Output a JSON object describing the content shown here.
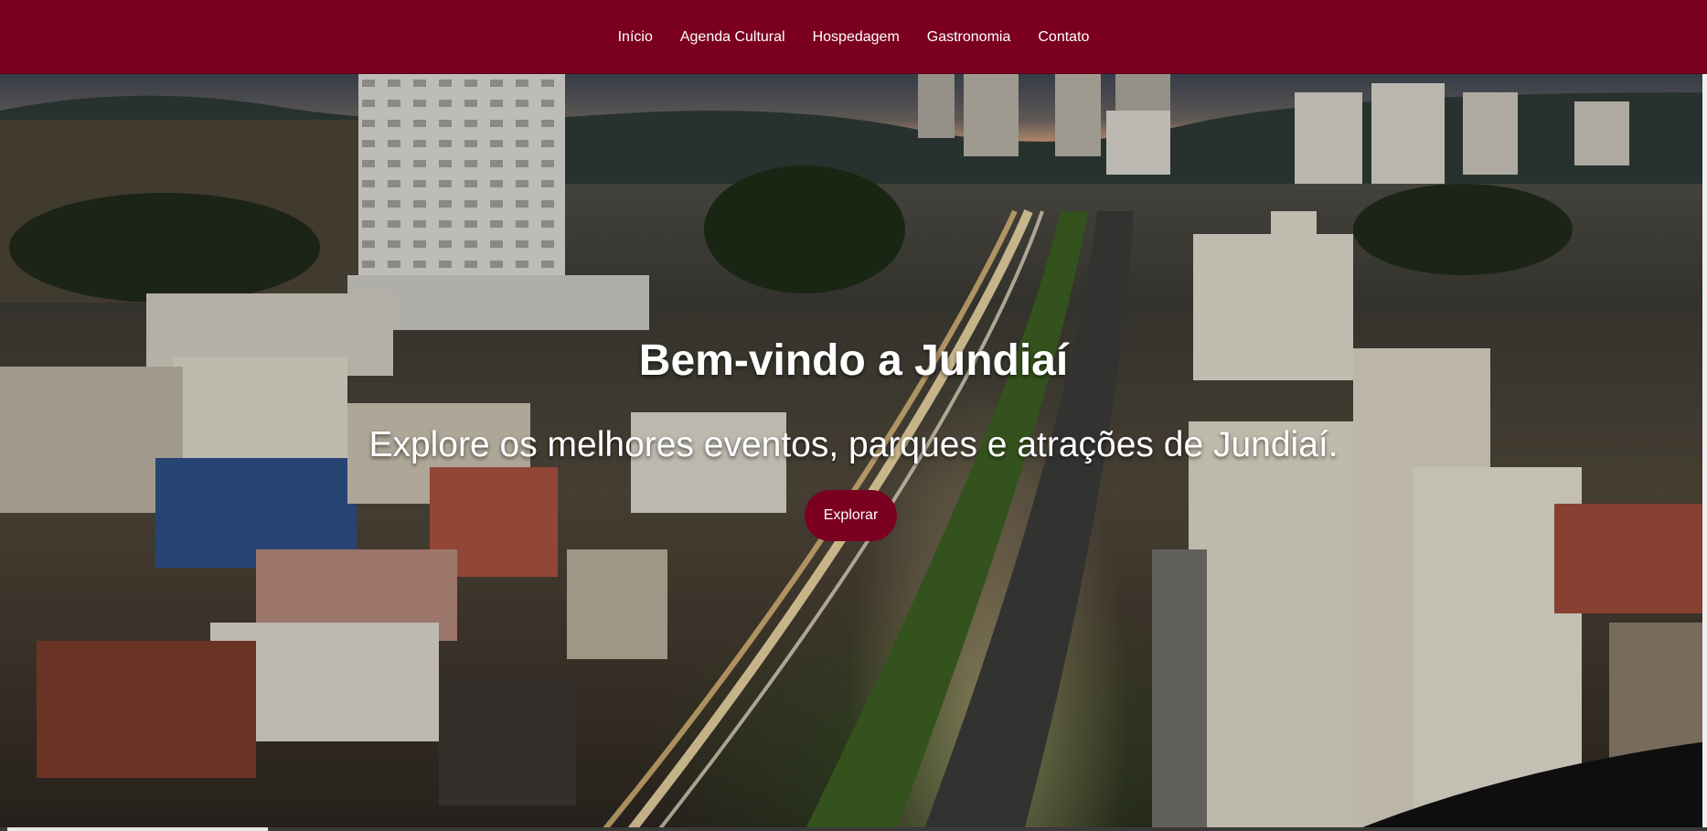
{
  "nav": {
    "items": [
      "Início",
      "Agenda Cultural",
      "Hospedagem",
      "Gastronomia",
      "Contato"
    ]
  },
  "hero": {
    "title": "Bem-vindo a Jundiaí",
    "subtitle": "Explore os melhores eventos, parques e atrações de Jundiaí.",
    "button_label": "Explorar",
    "background_image": "city-night-aerial-photo"
  },
  "colors": {
    "brand": "#7b0020",
    "text_on_brand": "#ffffff"
  }
}
